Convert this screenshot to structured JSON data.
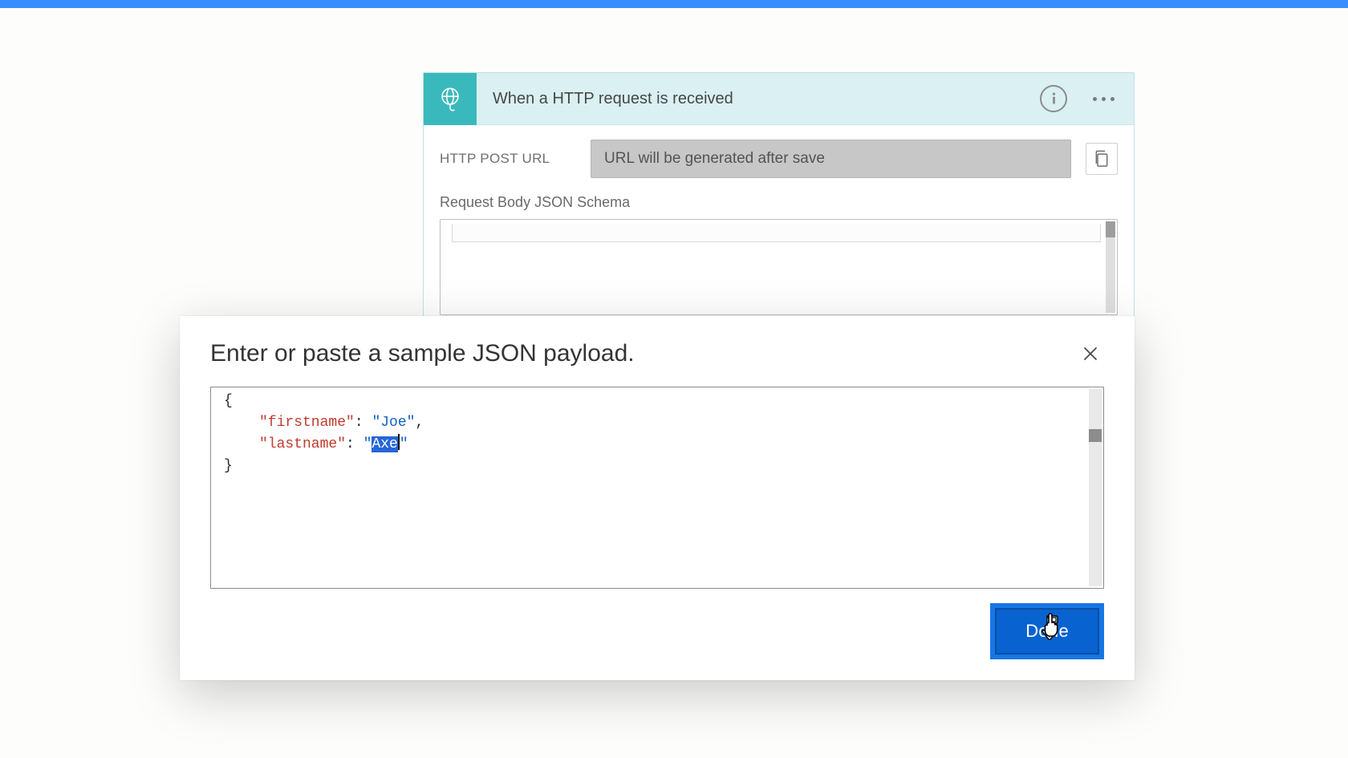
{
  "trigger_card": {
    "title": "When a HTTP request is received",
    "url_label": "HTTP POST URL",
    "url_placeholder": "URL will be generated after save",
    "schema_label": "Request Body JSON Schema"
  },
  "dialog": {
    "title": "Enter or paste a sample JSON payload.",
    "done_label": "Done",
    "sample": {
      "line1_key": "\"firstname\"",
      "line1_val": "\"Joe\"",
      "line2_key": "\"lastname\"",
      "line2_val_prefix": "\"",
      "line2_val_selected": "Axe",
      "line2_val_suffix": "\"",
      "open_brace": "{",
      "close_brace": "}",
      "colon_space": ": ",
      "comma": ","
    }
  }
}
